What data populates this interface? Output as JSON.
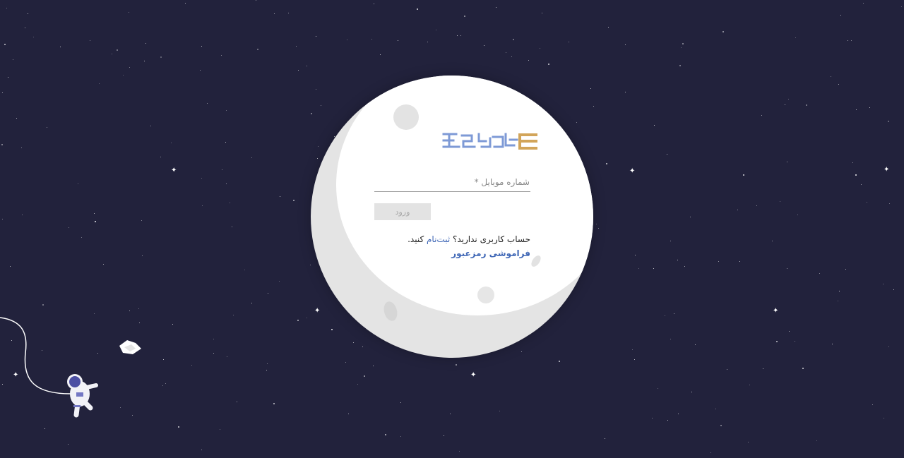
{
  "login_form": {
    "mobile_label": "شماره موبایل *",
    "mobile_value": "",
    "login_button_label": "ورود",
    "no_account_text": "حساب کاربری ندارید؟",
    "signup_link_label": "ثبت‌نام",
    "signup_suffix": "کنید.",
    "forgot_password_label": "فراموشی رمزعبور"
  },
  "colors": {
    "background": "#22223c",
    "moon": "#ffffff",
    "moon_shadow": "#e4e4e4",
    "link": "#3f67b6",
    "logo_blue": "#7e9ad6",
    "logo_gold": "#d2a55a",
    "button_disabled": "#e3e3e3"
  },
  "icons": {
    "logo": "brand-logo",
    "astronaut": "astronaut-illustration",
    "debris": "paper-debris-illustration",
    "moon": "moon-illustration"
  }
}
